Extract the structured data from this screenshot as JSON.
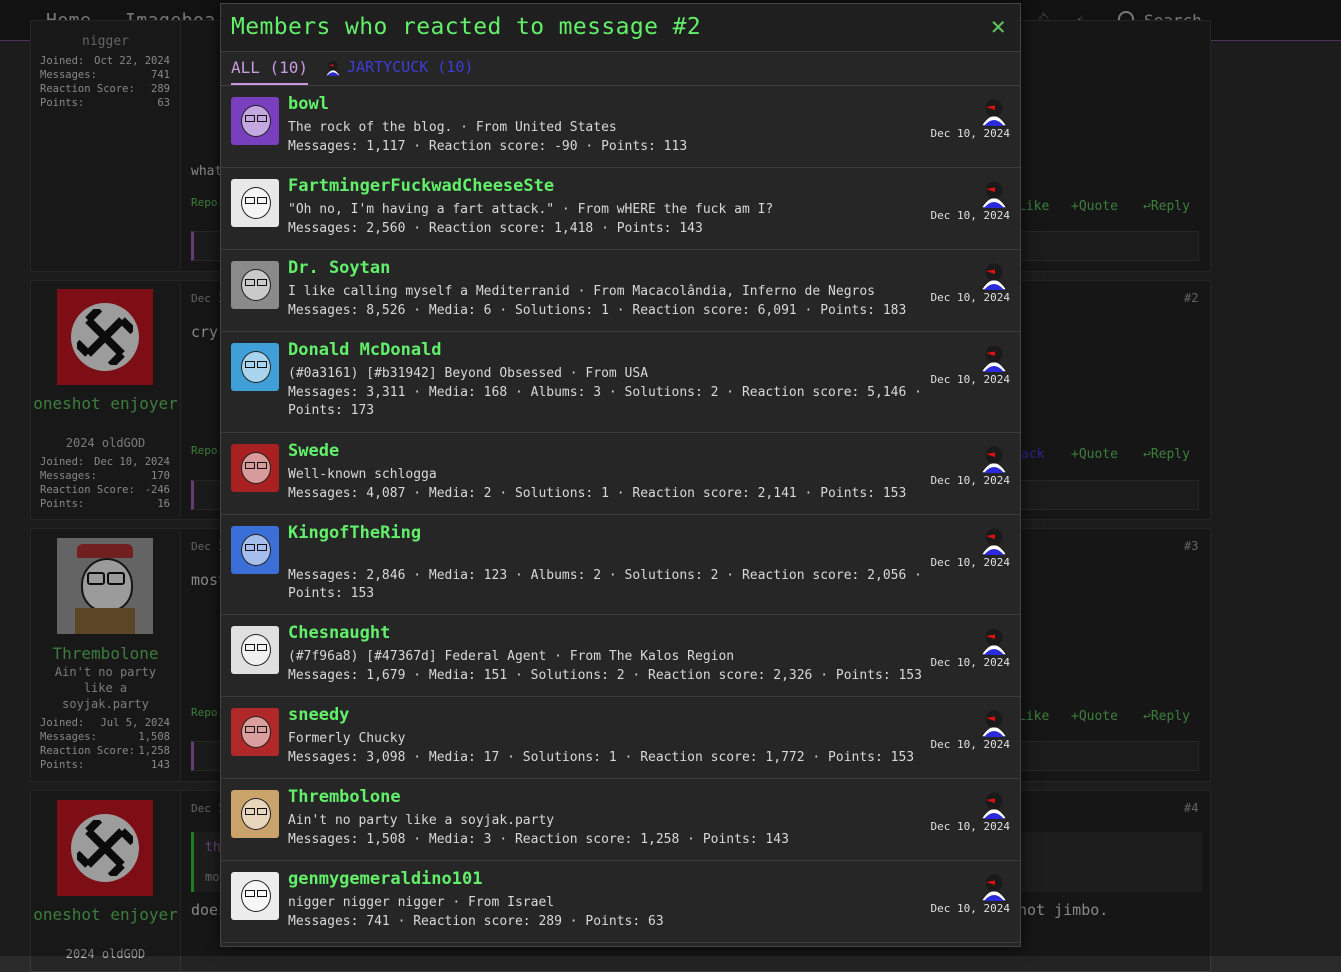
{
  "nav": {
    "home": "Home",
    "imageboard": "Imageboa",
    "search": "Search"
  },
  "background": {
    "post1": {
      "username_tail": "nigger",
      "stats": [
        {
          "label": "Joined:",
          "value": "Oct 22, 2024"
        },
        {
          "label": "Messages:",
          "value": "741"
        },
        {
          "label": "Reaction Score:",
          "value": "289"
        },
        {
          "label": "Points:",
          "value": "63"
        }
      ],
      "text": "what",
      "report": "Repo",
      "like": "Like",
      "quote": "Quote",
      "reply": "Reply"
    },
    "post2": {
      "username": "oneshot enjoyer",
      "title": "2024 oldGOD",
      "stats": [
        {
          "label": "Joined:",
          "value": "Dec 10, 2024"
        },
        {
          "label": "Messages:",
          "value": "170"
        },
        {
          "label": "Reaction Score:",
          "value": "-246"
        },
        {
          "label": "Points:",
          "value": "16"
        }
      ],
      "date": "Dec 1",
      "text": "cry",
      "report": "Repo",
      "like": "ack",
      "quote": "Quote",
      "reply": "Reply",
      "num": "#2"
    },
    "post3": {
      "username": "Thrembolone",
      "title": "Ain't no party like a soyjak.party",
      "stats": [
        {
          "label": "Joined:",
          "value": "Jul 5, 2024"
        },
        {
          "label": "Messages:",
          "value": "1,508"
        },
        {
          "label": "Reaction Score:",
          "value": "1,258"
        },
        {
          "label": "Points:",
          "value": "143"
        }
      ],
      "date": "Dec 1",
      "text": "most",
      "report": "Repo",
      "like": "Like",
      "quote": "Quote",
      "reply": "Reply",
      "num": "#3"
    },
    "post4": {
      "username": "oneshot enjoyer",
      "title": "2024 oldGOD",
      "date": "Dec 1",
      "quote_text": "th",
      "quote_sub": "mo",
      "text": "does",
      "text_tail": "not jimbo.",
      "num": "#4"
    }
  },
  "modal": {
    "title": "Members who reacted to message #2",
    "close": "×",
    "tab_all": "ALL (10)",
    "tab_react": "JARTYCUCK (10)",
    "members": [
      {
        "name": "bowl",
        "line1": "The rock of the blog. · From United States",
        "line2": "Messages: 1,117 · Reaction score: -90 · Points: 113",
        "date": "Dec 10, 2024",
        "avatar": "#7a3fbf"
      },
      {
        "name": "FartmingerFuckwadCheeseSte",
        "line1": "\"Oh no, I'm having a fart attack.\" · From wHERE the fuck am I?",
        "line2": "Messages: 2,560 · Reaction score: 1,418 · Points: 143",
        "date": "Dec 10, 2024",
        "avatar": "#e8e8e8"
      },
      {
        "name": "Dr. Soytan",
        "line1": "I like calling myself a Mediterranid · From Macacolândia, Inferno de Negros",
        "line2": "Messages: 8,526 · Media: 6 · Solutions: 1 · Reaction score: 6,091 · Points: 183",
        "date": "Dec 10, 2024",
        "avatar": "#8a8a8a"
      },
      {
        "name": "Donald McDonald",
        "line1": "(#0a3161) [#b31942] Beyond Obsessed · From USA",
        "line2": "Messages: 3,311 · Media: 168 · Albums: 3 · Solutions: 2 · Reaction score: 5,146 · Points: 173",
        "date": "Dec 10, 2024",
        "avatar": "#3fa0d8"
      },
      {
        "name": "Swede",
        "line1": "Well-known schlogga",
        "line2": "Messages: 4,087 · Media: 2 · Solutions: 1 · Reaction score: 2,141 · Points: 153",
        "date": "Dec 10, 2024",
        "avatar": "#a82020"
      },
      {
        "name": "KingofTheRing",
        "line1": "",
        "line2": "Messages: 2,846 · Media: 123 · Albums: 2 · Solutions: 2 · Reaction score: 2,056 · Points: 153",
        "date": "Dec 10, 2024",
        "avatar": "#3a6fd8"
      },
      {
        "name": "Chesnaught",
        "line1": "(#7f96a8) [#47367d] Federal Agent · From The Kalos Region",
        "line2": "Messages: 1,679 · Media: 151 · Solutions: 2 · Reaction score: 2,326 · Points: 153",
        "date": "Dec 10, 2024",
        "avatar": "#e0e0e0"
      },
      {
        "name": "sneedy",
        "line1": "Formerly Chucky",
        "line2": "Messages: 3,098 · Media: 17 · Solutions: 1 · Reaction score: 1,772 · Points: 153",
        "date": "Dec 10, 2024",
        "avatar": "#b02828"
      },
      {
        "name": "Thrembolone",
        "line1": "Ain't no party like a soyjak.party",
        "line2": "Messages: 1,508 · Media: 3 · Reaction score: 1,258 · Points: 143",
        "date": "Dec 10, 2024",
        "avatar": "#c9a36a"
      },
      {
        "name": "genmygemeraldino101",
        "line1": "nigger nigger nigger · From Israel",
        "line2": "Messages: 741 · Reaction score: 289 · Points: 63",
        "date": "Dec 10, 2024",
        "avatar": "#ececec"
      }
    ]
  }
}
